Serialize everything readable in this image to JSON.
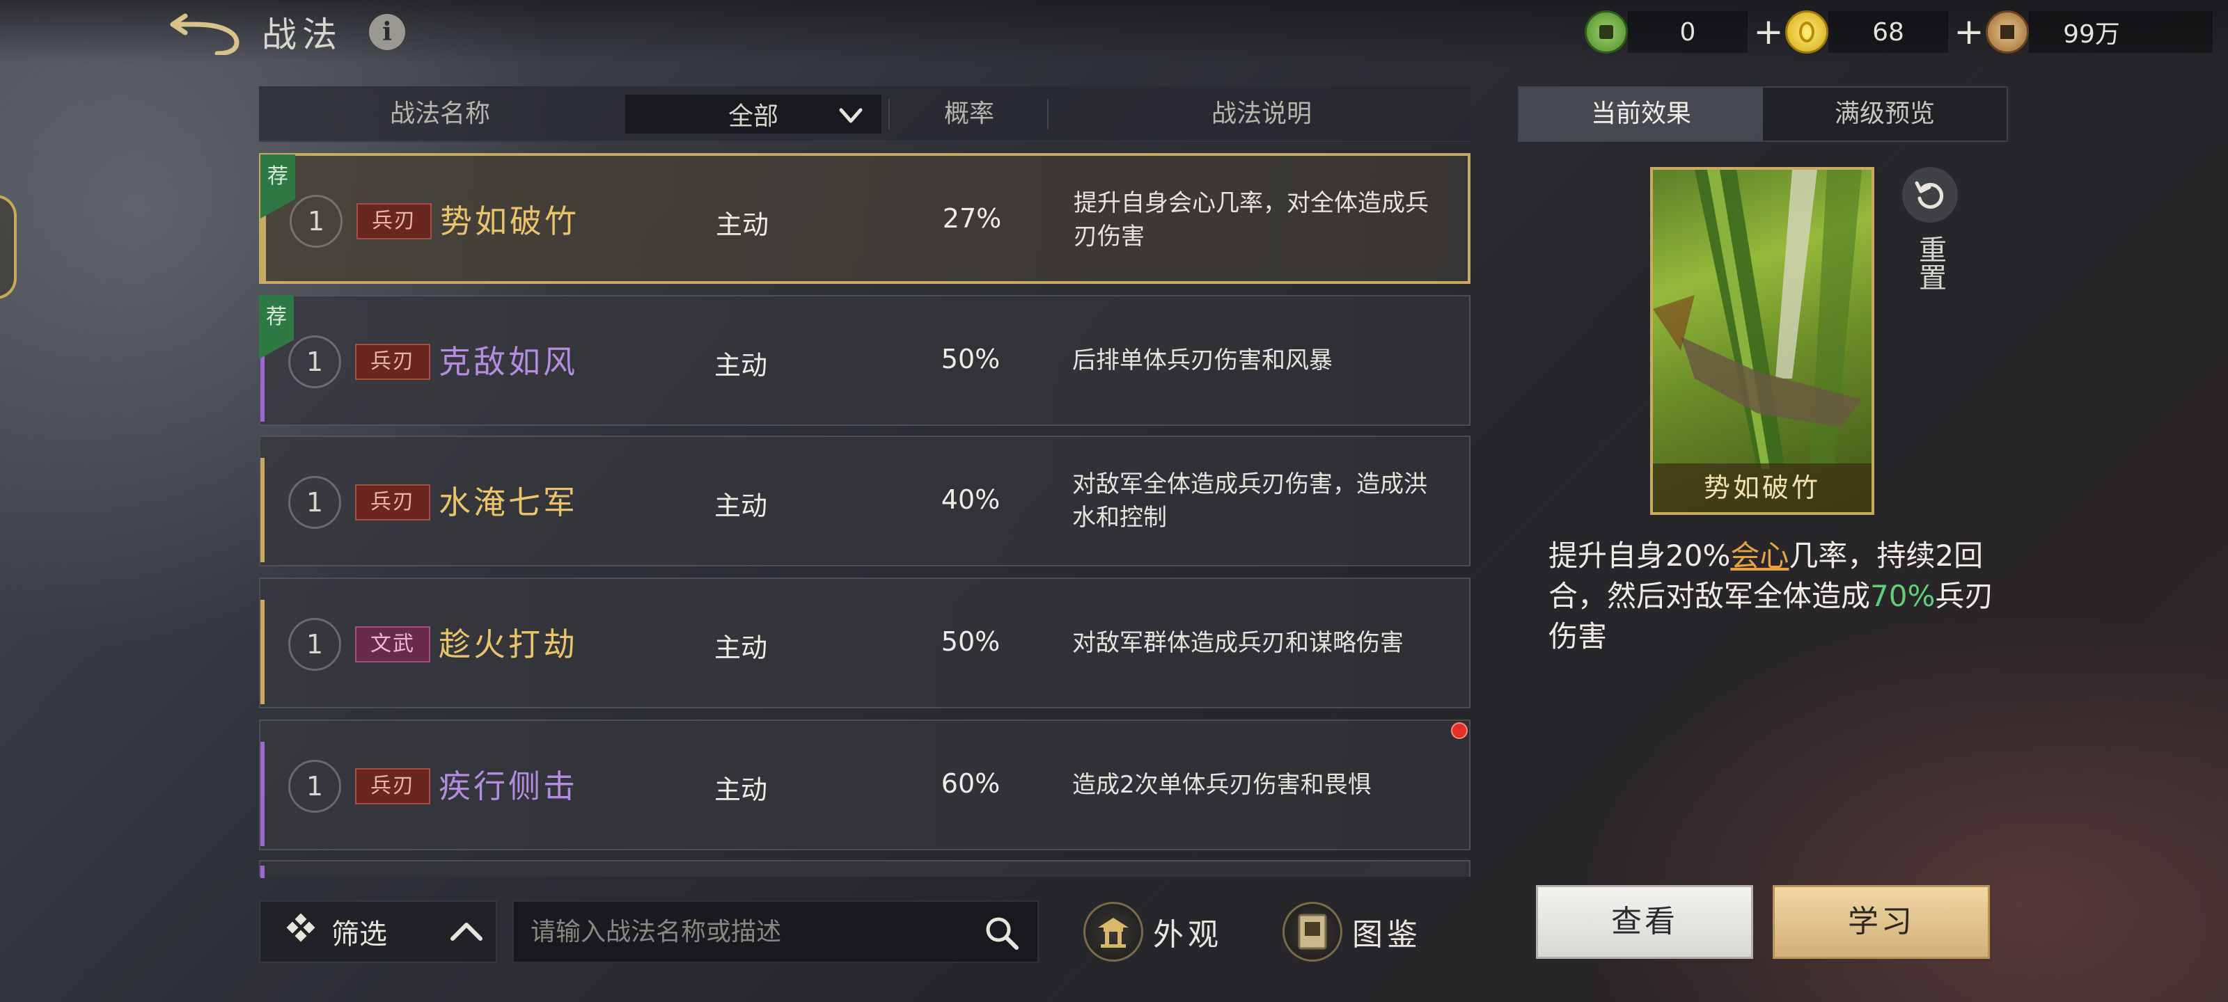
{
  "header": {
    "title": "战法",
    "currencies": [
      {
        "icon": "jade-coin-icon",
        "value": "0",
        "has_plus": true
      },
      {
        "icon": "gold-coin-icon",
        "value": "68",
        "has_plus": true
      },
      {
        "icon": "copper-coin-icon",
        "value": "99万",
        "has_plus": false
      }
    ]
  },
  "list": {
    "headers": {
      "name": "战法名称",
      "filter": "全部",
      "rate": "概率",
      "desc": "战法说明"
    },
    "rows": [
      {
        "recommended": true,
        "rec_label": "荐",
        "level": "1",
        "type_tag": "兵刃",
        "name": "势如破竹",
        "name_color": "#e9c46a",
        "kind": "主动",
        "rate": "27%",
        "desc": "提升自身会心几率，对全体造成兵刃伤害",
        "selected": true,
        "bar_color": "#c9aa62",
        "red_dot": false
      },
      {
        "recommended": true,
        "rec_label": "荐",
        "level": "1",
        "type_tag": "兵刃",
        "name": "克敌如风",
        "name_color": "#b48ce0",
        "kind": "主动",
        "rate": "50%",
        "desc": "后排单体兵刃伤害和风暴",
        "selected": false,
        "bar_color": "#9a6ad0",
        "red_dot": false
      },
      {
        "recommended": false,
        "rec_label": "",
        "level": "1",
        "type_tag": "兵刃",
        "name": "水淹七军",
        "name_color": "#e9c46a",
        "kind": "主动",
        "rate": "40%",
        "desc": "对敌军全体造成兵刃伤害，造成洪水和控制",
        "selected": false,
        "bar_color": "#c9aa62",
        "red_dot": false
      },
      {
        "recommended": false,
        "rec_label": "",
        "level": "1",
        "type_tag": "文武",
        "name": "趁火打劫",
        "name_color": "#e9c46a",
        "kind": "主动",
        "rate": "50%",
        "desc": "对敌军群体造成兵刃和谋略伤害",
        "selected": false,
        "bar_color": "#c9aa62",
        "red_dot": false
      },
      {
        "recommended": false,
        "rec_label": "",
        "level": "1",
        "type_tag": "兵刃",
        "name": "疾行侧击",
        "name_color": "#b48ce0",
        "kind": "主动",
        "rate": "60%",
        "desc": "造成2次单体兵刃伤害和畏惧",
        "selected": false,
        "bar_color": "#9a6ad0",
        "red_dot": true
      }
    ]
  },
  "toolbar": {
    "filter_label": "筛选",
    "search_placeholder": "请输入战法名称或描述",
    "appearance_label": "外观",
    "codex_label": "图鉴"
  },
  "detail": {
    "tabs": [
      "当前效果",
      "满级预览"
    ],
    "active_tab": 0,
    "card_name": "势如破竹",
    "reset_label": "重置",
    "effect": {
      "part1": "提升自身20%",
      "hl1": "会心",
      "part2": "几率，持续2回合，然后对敌军全体造成",
      "hl2": "70%",
      "part3": "兵刃伤害"
    },
    "view_label": "查看",
    "learn_label": "学习"
  },
  "colors": {
    "gold_accent": "#c9aa62",
    "purple_accent": "#9a6ad0",
    "highlight_gold": "#e6a341",
    "highlight_green": "#5fcf7a"
  }
}
